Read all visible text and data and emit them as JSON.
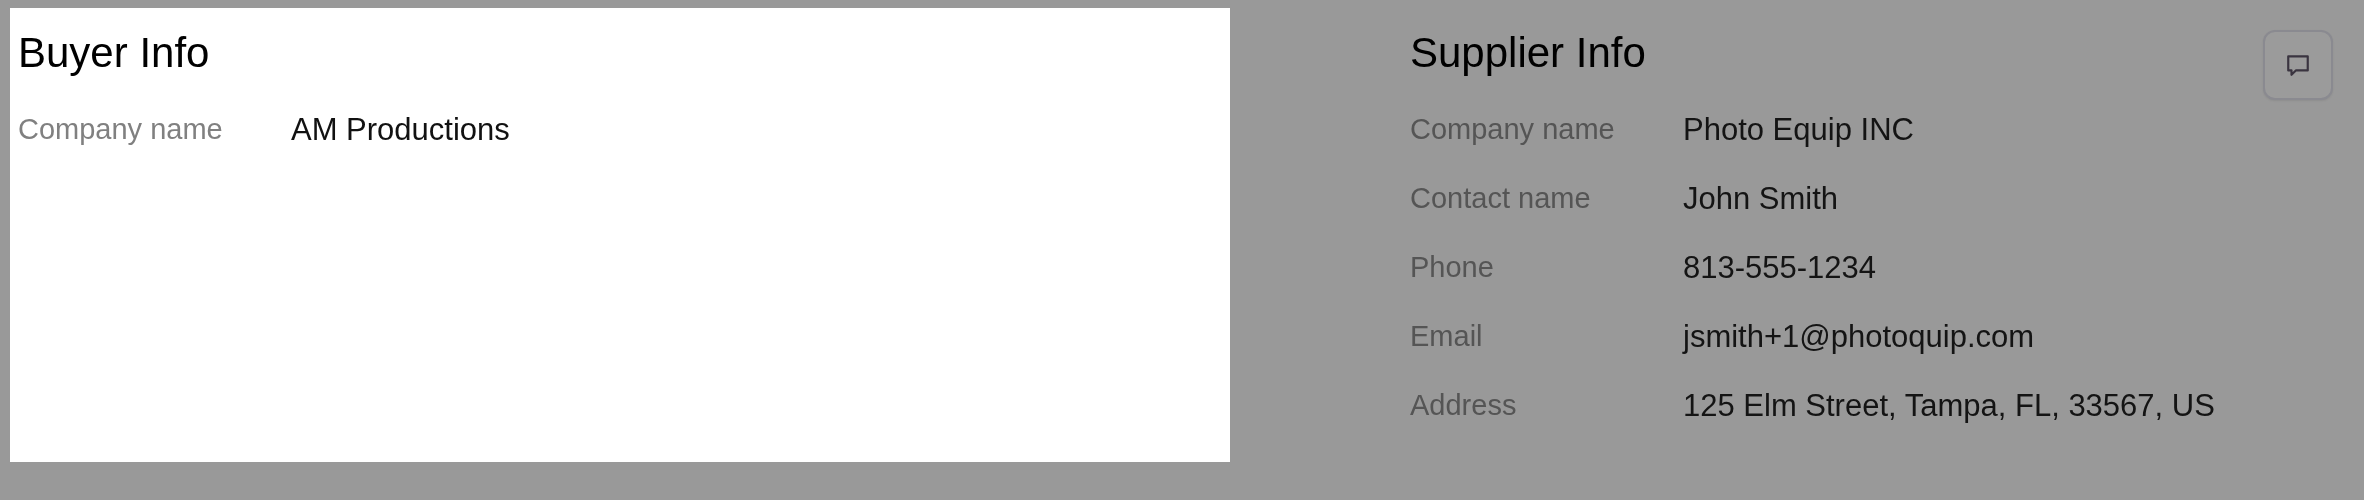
{
  "buyer": {
    "title": "Buyer Info",
    "fields": [
      {
        "label": "Company name",
        "value": "AM Productions"
      }
    ]
  },
  "supplier": {
    "title": "Supplier Info",
    "fields": [
      {
        "label": "Company name",
        "value": "Photo Equip INC"
      },
      {
        "label": "Contact name",
        "value": "John Smith"
      },
      {
        "label": "Phone",
        "value": "813-555-1234"
      },
      {
        "label": "Email",
        "value": "jsmith+1@photoquip.com"
      },
      {
        "label": "Address",
        "value": "125 Elm Street, Tampa, FL, 33567, US"
      }
    ]
  }
}
